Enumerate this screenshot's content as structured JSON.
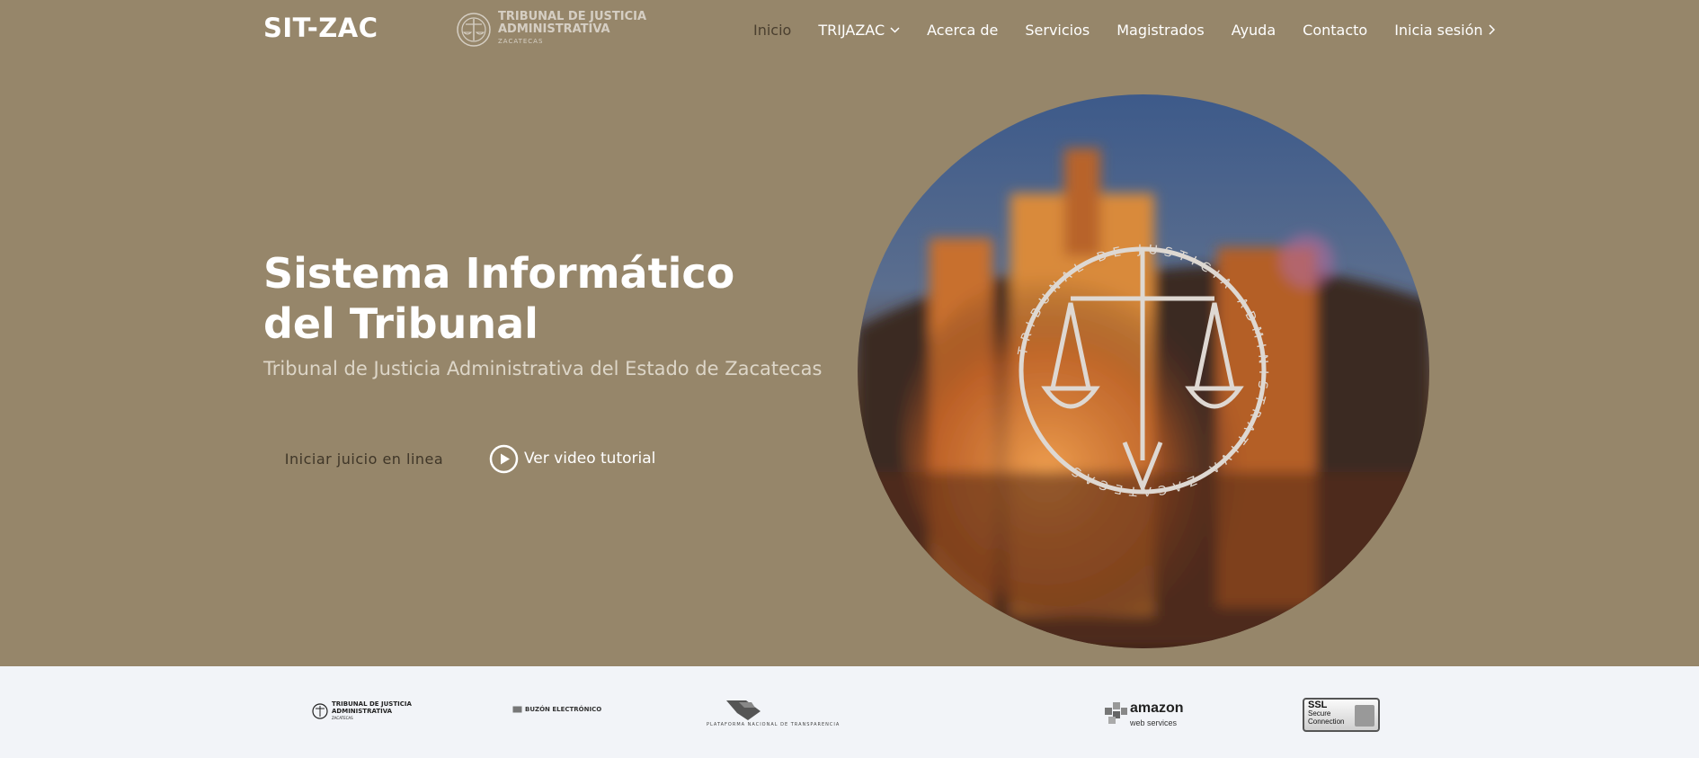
{
  "header": {
    "brand": "SIT-ZAC",
    "logo": {
      "line1": "TRIBUNAL DE JUSTICIA",
      "line2": "ADMINISTRATIVA",
      "line3": "ZACATECAS"
    },
    "nav": [
      {
        "label": "Inicio",
        "active": true
      },
      {
        "label": "TRIJAZAC",
        "dropdown": true
      },
      {
        "label": "Acerca de"
      },
      {
        "label": "Servicios"
      },
      {
        "label": "Magistrados"
      },
      {
        "label": "Ayuda"
      },
      {
        "label": "Contacto"
      },
      {
        "label": "Inicia sesión",
        "chevron": true
      }
    ]
  },
  "hero": {
    "title": "Sistema Informático del Tribunal",
    "subtitle": "Tribunal de Justicia Administrativa del Estado de Zacatecas",
    "primary_button": "Iniciar juicio en linea",
    "video_button": "Ver video tutorial",
    "seal_text": "TRIBUNAL DE JUSTICIA ADMINISTRATIVA ZACATECAS",
    "background_color": "#96866a"
  },
  "partners": {
    "tjaz": {
      "line1": "TRIBUNAL DE JUSTICIA",
      "line2": "ADMINISTRATIVA",
      "line3": "ZACATECAS"
    },
    "buzon": "BUZÓN ELECTRÓNICO",
    "pnt": "PLATAFORMA NACIONAL DE TRANSPARENCIA",
    "aws": {
      "line1": "amazon",
      "line2": "web services"
    },
    "ssl": {
      "line1": "SSL",
      "line2": "Secure",
      "line3": "Connection"
    }
  }
}
